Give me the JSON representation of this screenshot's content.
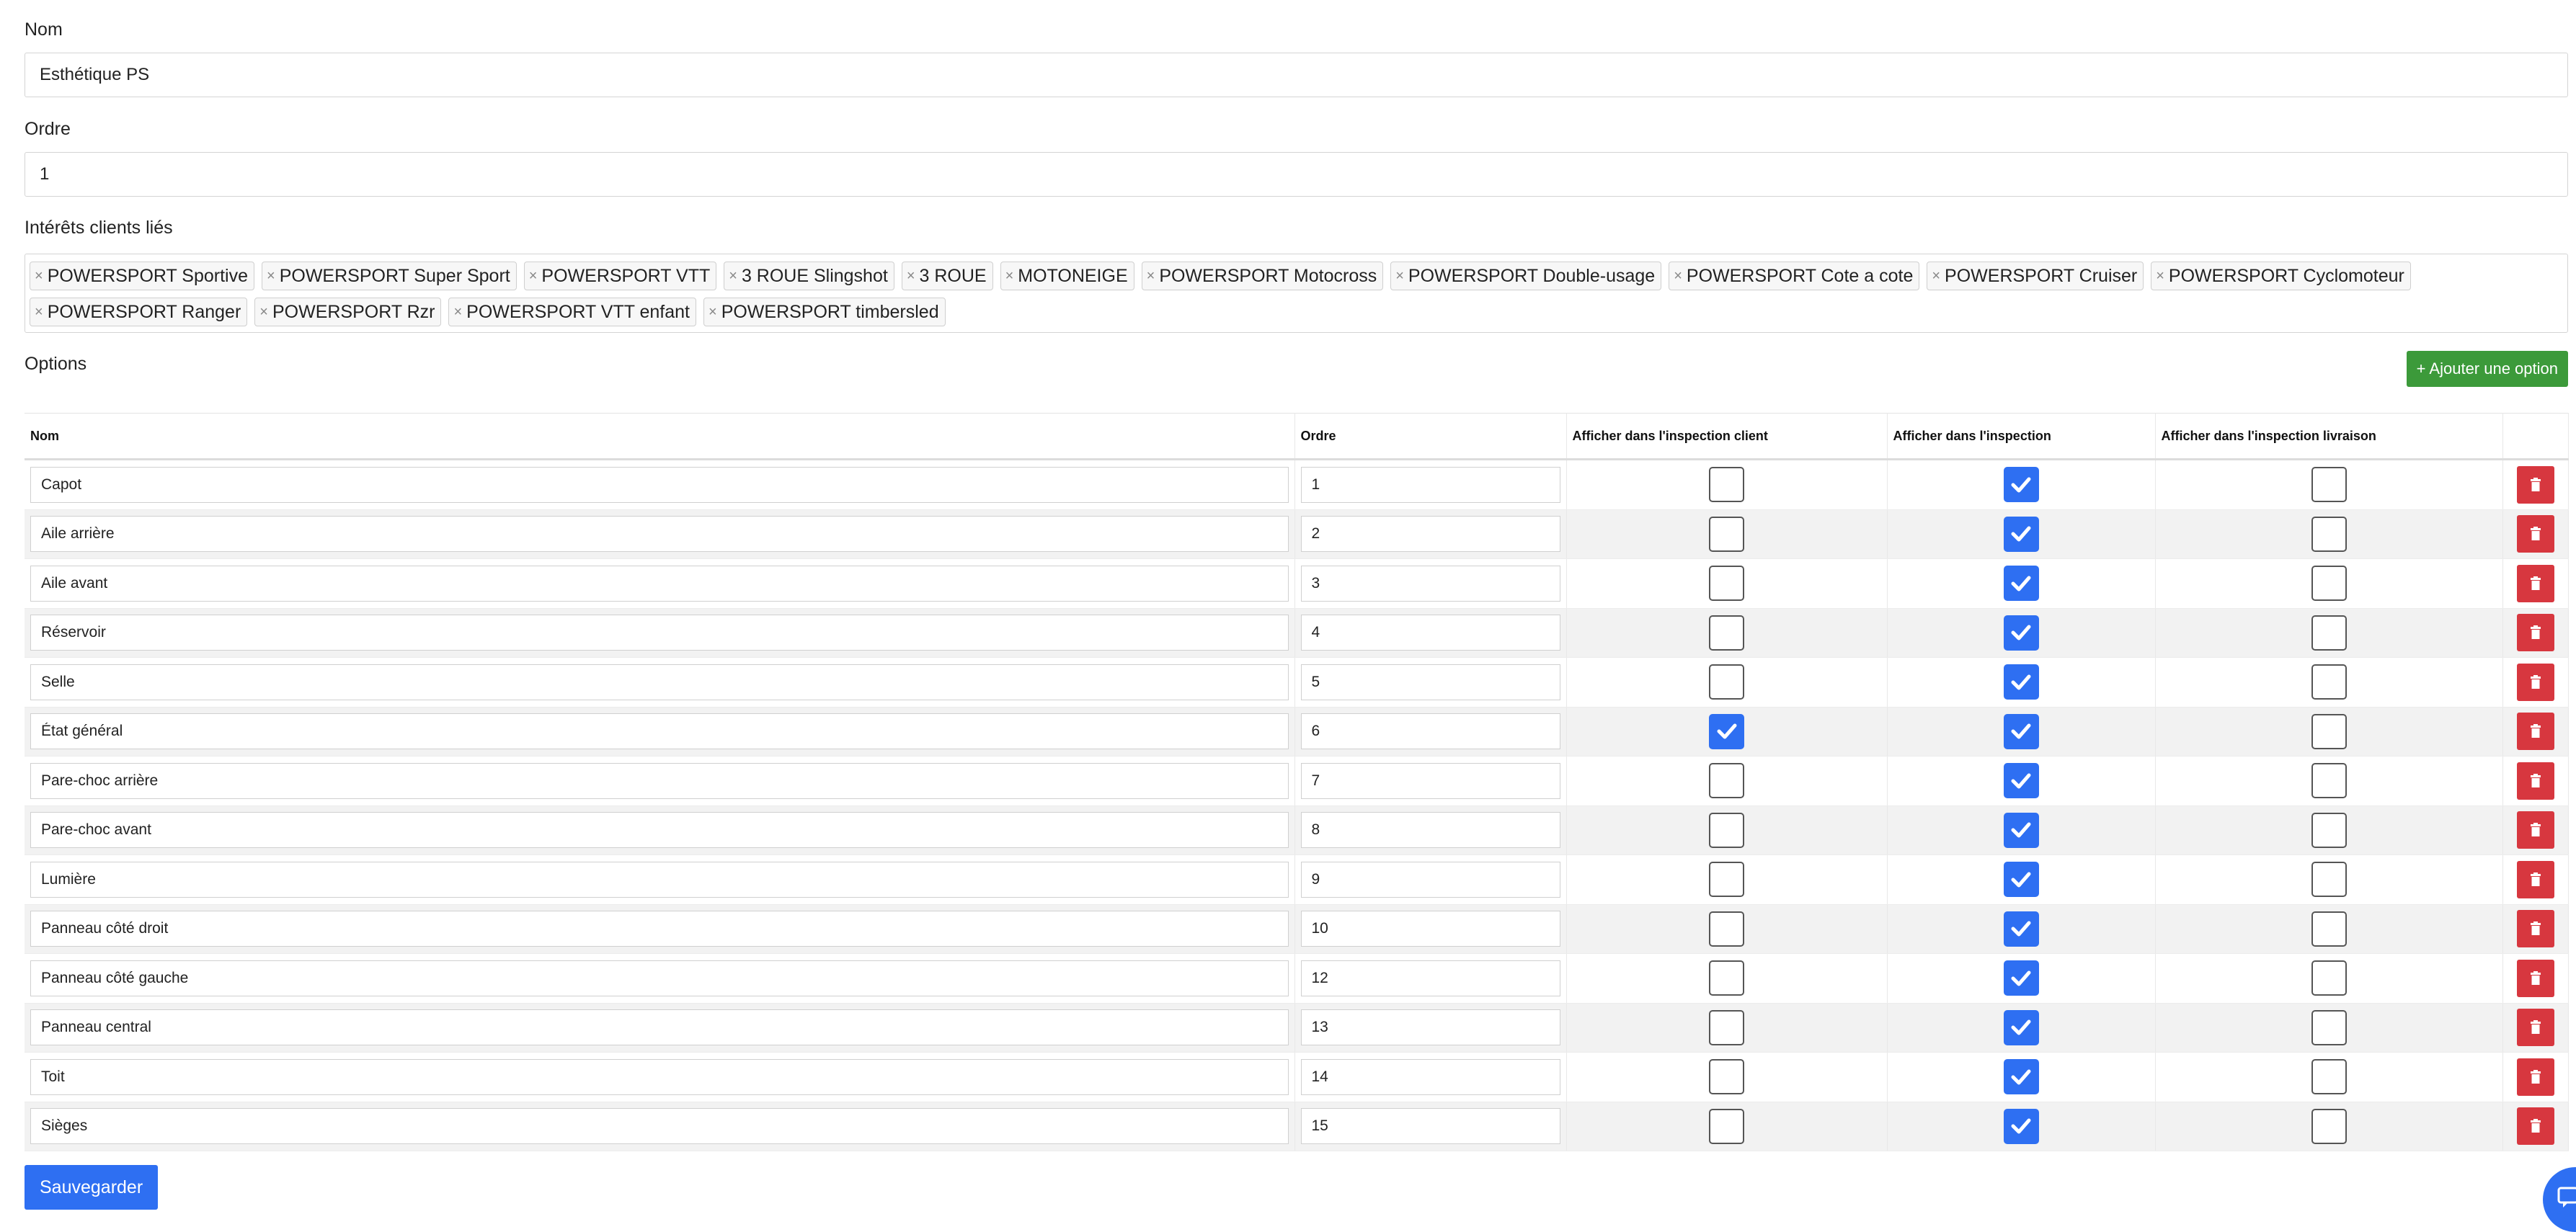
{
  "form": {
    "name_label": "Nom",
    "name_value": "Esthétique PS",
    "order_label": "Ordre",
    "order_value": "1",
    "interests_label": "Intérêts clients liés",
    "remove_symbol": "×",
    "interests": [
      "POWERSPORT Sportive",
      "POWERSPORT Super Sport",
      "POWERSPORT VTT",
      "3 ROUE Slingshot",
      "3 ROUE",
      "MOTONEIGE",
      "POWERSPORT Motocross",
      "POWERSPORT Double-usage",
      "POWERSPORT Cote a cote",
      "POWERSPORT Cruiser",
      "POWERSPORT Cyclomoteur",
      "POWERSPORT Ranger",
      "POWERSPORT Rzr",
      "POWERSPORT VTT enfant",
      "POWERSPORT timbersled"
    ]
  },
  "options": {
    "label": "Options",
    "add_button": "+ Ajouter une option",
    "columns": [
      "Nom",
      "Ordre",
      "Afficher dans l'inspection client",
      "Afficher dans l'inspection",
      "Afficher dans l'inspection livraison"
    ],
    "rows": [
      {
        "name": "Capot",
        "order": "1",
        "client": false,
        "inspection": true,
        "delivery": false
      },
      {
        "name": "Aile arrière",
        "order": "2",
        "client": false,
        "inspection": true,
        "delivery": false
      },
      {
        "name": "Aile avant",
        "order": "3",
        "client": false,
        "inspection": true,
        "delivery": false
      },
      {
        "name": "Réservoir",
        "order": "4",
        "client": false,
        "inspection": true,
        "delivery": false
      },
      {
        "name": "Selle",
        "order": "5",
        "client": false,
        "inspection": true,
        "delivery": false
      },
      {
        "name": "État général",
        "order": "6",
        "client": true,
        "inspection": true,
        "delivery": false
      },
      {
        "name": "Pare-choc arrière",
        "order": "7",
        "client": false,
        "inspection": true,
        "delivery": false
      },
      {
        "name": "Pare-choc avant",
        "order": "8",
        "client": false,
        "inspection": true,
        "delivery": false
      },
      {
        "name": "Lumière",
        "order": "9",
        "client": false,
        "inspection": true,
        "delivery": false
      },
      {
        "name": "Panneau côté droit",
        "order": "10",
        "client": false,
        "inspection": true,
        "delivery": false
      },
      {
        "name": "Panneau côté gauche",
        "order": "12",
        "client": false,
        "inspection": true,
        "delivery": false
      },
      {
        "name": "Panneau central",
        "order": "13",
        "client": false,
        "inspection": true,
        "delivery": false
      },
      {
        "name": "Toit",
        "order": "14",
        "client": false,
        "inspection": true,
        "delivery": false
      },
      {
        "name": "Sièges",
        "order": "15",
        "client": false,
        "inspection": true,
        "delivery": false
      }
    ]
  },
  "save_button": "Sauvegarder",
  "colors": {
    "primary": "#2e6ff2",
    "success": "#3c9a3a",
    "danger": "#d7373f",
    "row_alt": "#f2f2f2"
  },
  "icons": {
    "delete": "trash-icon",
    "checked": "checkmark-icon",
    "chat": "chat-icon"
  }
}
